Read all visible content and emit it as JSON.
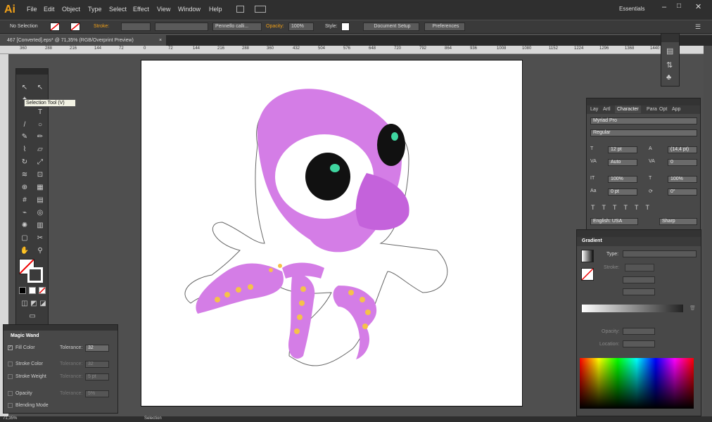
{
  "app": {
    "logo": "Ai"
  },
  "menu": [
    "File",
    "Edit",
    "Object",
    "Type",
    "Select",
    "Effect",
    "View",
    "Window",
    "Help"
  ],
  "workspace": "Essentials",
  "control_bar": {
    "selection": "No Selection",
    "stroke_label": "Stroke:",
    "brush": "Pennello calli...",
    "opacity_label": "Opacity:",
    "opacity": "100%",
    "style_label": "Style:",
    "doc_setup": "Document Setup",
    "preferences": "Preferences"
  },
  "document_tab": {
    "title": "467 [Converted].eps* @ 71,35% (RGB/Overprint Preview)",
    "close": "×"
  },
  "ruler_labels": [
    "360",
    "288",
    "216",
    "144",
    "72",
    "0",
    "72",
    "144",
    "216",
    "288",
    "360",
    "432",
    "504",
    "576",
    "648",
    "720",
    "792",
    "864",
    "936",
    "1008",
    "1080",
    "1152",
    "1224",
    "1296",
    "1368",
    "1440"
  ],
  "tooltip": "Selection Tool (V)",
  "character_panel": {
    "tabs": [
      "Lay",
      "Artl",
      "Character",
      "Para",
      "Opt",
      "App"
    ],
    "font": "Myriad Pro",
    "style": "Regular",
    "size": "12 pt",
    "leading": "(14,4 pt)",
    "kerning": "Auto",
    "tracking": "0",
    "v_scale": "100%",
    "h_scale": "100%",
    "baseline": "0 pt",
    "rotation": "0°",
    "language": "English: USA",
    "aa": "Sharp"
  },
  "gradient_panel": {
    "title": "Gradient",
    "type_label": "Type:",
    "stroke_label": "Stroke:",
    "opacity_label": "Opacity:",
    "location_label": "Location:"
  },
  "magic_wand": {
    "title": "Magic Wand",
    "rows": [
      {
        "label": "Fill Color",
        "checked": true,
        "tol": "32"
      },
      {
        "label": "Stroke Color",
        "checked": false,
        "tol": "32"
      },
      {
        "label": "Stroke Weight",
        "checked": false,
        "tol": "5 pt"
      },
      {
        "label": "Opacity",
        "checked": false,
        "tol": "5%"
      },
      {
        "label": "Blending Mode",
        "checked": false,
        "tol": ""
      }
    ],
    "tol_label": "Tolerance:"
  },
  "status": {
    "zoom": "71,35%",
    "mode": "Selection"
  },
  "colors": {
    "octopus": "#d47de6",
    "spots": "#f5c24a",
    "accent": "#f0a019"
  }
}
